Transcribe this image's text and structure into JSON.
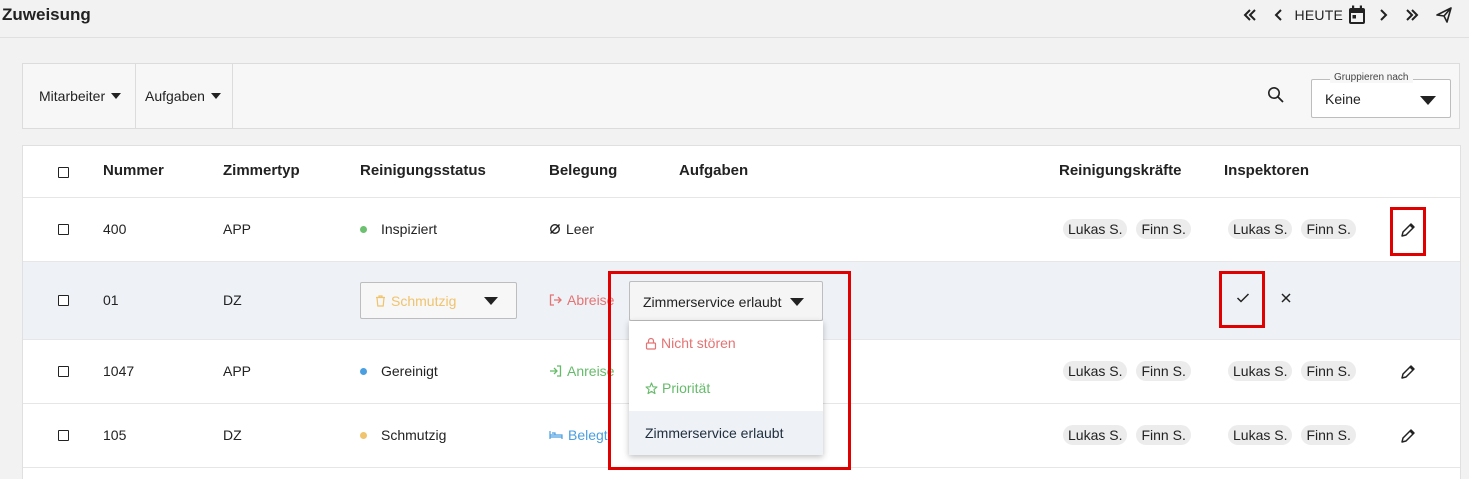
{
  "header": {
    "title": "Zuweisung",
    "today_label": "HEUTE"
  },
  "filters": {
    "employees_label": "Mitarbeiter",
    "tasks_label": "Aufgaben"
  },
  "grouping": {
    "legend": "Gruppieren nach",
    "value": "Keine"
  },
  "table": {
    "columns": {
      "number": "Nummer",
      "room_type": "Zimmertyp",
      "cleaning_status": "Reinigungsstatus",
      "occupancy": "Belegung",
      "tasks": "Aufgaben",
      "cleaners": "Reinigungskräfte",
      "inspectors": "Inspektoren"
    },
    "rows": [
      {
        "number": "400",
        "room_type": "APP",
        "status": "Inspiziert",
        "status_color": "#6cc070",
        "occupancy": "Leer",
        "cleaners": [
          "Lukas S.",
          "Finn S."
        ],
        "inspectors": [
          "Lukas S.",
          "Finn S."
        ]
      },
      {
        "number": "01",
        "room_type": "DZ",
        "status": "Schmutzig",
        "status_color": "#f0c36d",
        "occupancy": "Abreise",
        "occupancy_color": "#e57373",
        "task_value": "Zimmerservice erlaubt",
        "editing": true
      },
      {
        "number": "1047",
        "room_type": "APP",
        "status": "Gereinigt",
        "status_color": "#4a9fe0",
        "occupancy": "Anreise",
        "occupancy_color": "#66bb6a",
        "cleaners": [
          "Lukas S.",
          "Finn S."
        ],
        "inspectors": [
          "Lukas S.",
          "Finn S."
        ]
      },
      {
        "number": "105",
        "room_type": "DZ",
        "status": "Schmutzig",
        "status_color": "#f0c36d",
        "occupancy": "Belegt",
        "occupancy_color": "#4a9fe0",
        "cleaners": [
          "Lukas S.",
          "Finn S."
        ],
        "inspectors": [
          "Lukas S.",
          "Finn S."
        ]
      }
    ]
  },
  "task_menu": {
    "items": [
      {
        "label": "Nicht stören",
        "color": "#e57373",
        "icon": "lock-icon"
      },
      {
        "label": "Priorität",
        "color": "#66bb6a",
        "icon": "star-icon"
      },
      {
        "label": "Zimmerservice erlaubt",
        "color": "#1f2d3d",
        "selected": true
      }
    ]
  },
  "colors": {
    "highlight": "#e00000"
  }
}
